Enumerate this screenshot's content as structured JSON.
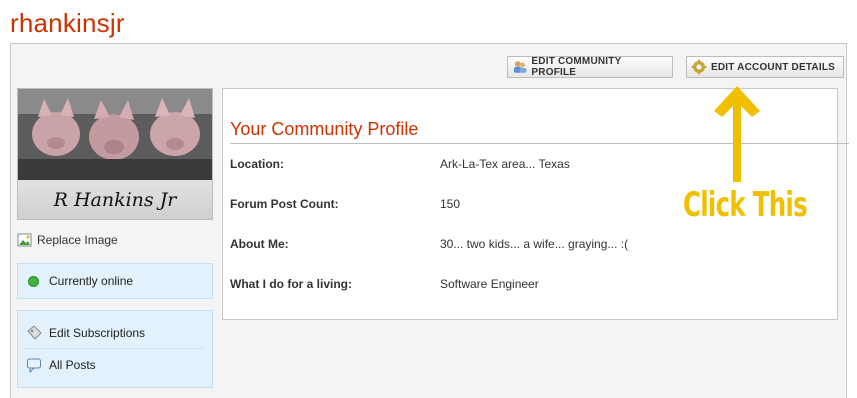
{
  "username": "rhankinsjr",
  "buttons": {
    "edit_community_profile": "EDIT COMMUNITY PROFILE",
    "edit_account_details": "EDIT ACCOUNT DETAILS"
  },
  "avatar": {
    "caption": "R Hankins Jr"
  },
  "replace_image": "Replace Image",
  "status": {
    "online": "Currently online"
  },
  "links": {
    "edit_subscriptions": "Edit Subscriptions",
    "all_posts": "All Posts"
  },
  "profile": {
    "title": "Your Community Profile",
    "rows": [
      {
        "label": "Location:",
        "value": "Ark-La-Tex area... Texas"
      },
      {
        "label": "Forum Post Count:",
        "value": "150"
      },
      {
        "label": "About Me:",
        "value": "30... two kids... a wife... graying... :("
      },
      {
        "label": "What I do for a living:",
        "value": "Software Engineer"
      }
    ]
  },
  "annotation": {
    "text": "Click This",
    "color": "#f0c000"
  },
  "colors": {
    "accent": "#cc3300",
    "sidebar_bg": "#e2f1fb",
    "online": "#3fb43f"
  }
}
